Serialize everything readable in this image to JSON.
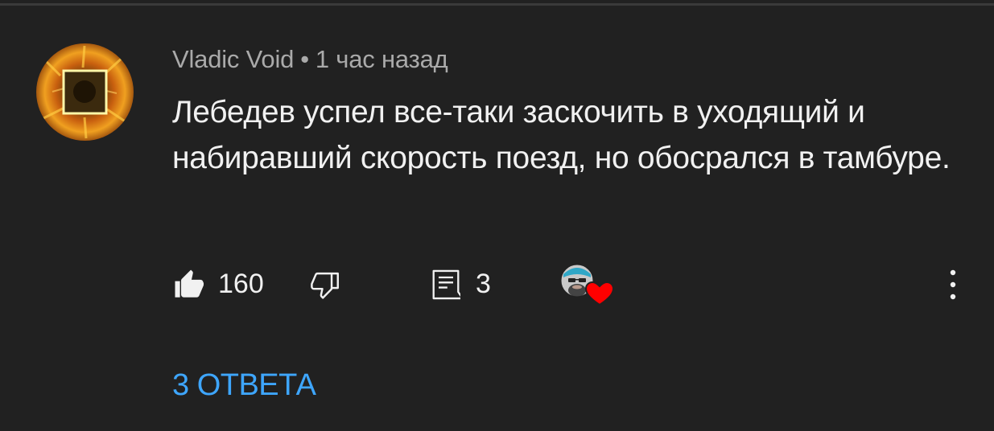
{
  "comment": {
    "author": "Vladic Void",
    "separator": "•",
    "timestamp": "1 час назад",
    "text": "Лебедев успел все-таки заскочить в уходящий и набиравший скорость поезд, но обосрался в тамбуре.",
    "like_count": "160",
    "reply_count": "3",
    "replies_link": "3 ОТВЕТА"
  },
  "icons": {
    "avatar": "avatar-fire-square",
    "like": "thumb-up-icon",
    "dislike": "thumb-down-icon",
    "reply": "comment-icon",
    "creator_heart": "creator-heart-badge",
    "more": "more-vert-icon"
  },
  "colors": {
    "background": "#212121",
    "text": "#f1f1f1",
    "meta_text": "#aaaaaa",
    "link": "#3ea6ff",
    "heart": "#ff0000"
  }
}
